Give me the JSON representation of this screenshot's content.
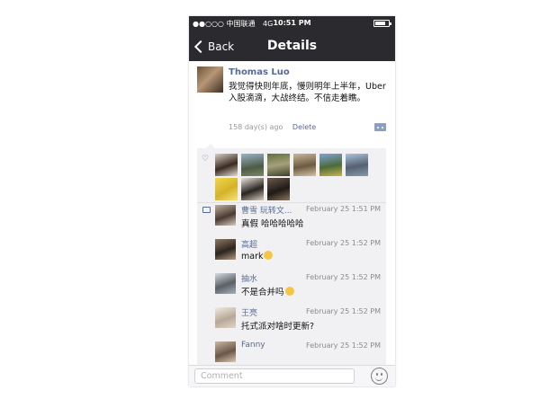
{
  "status_bar": {
    "signal": "●●○○○",
    "carrier": "中国联通",
    "network": "4G",
    "time": "10:51 PM"
  },
  "nav": {
    "back_label": "Back",
    "title": "Details"
  },
  "post": {
    "author": "Thomas Luo",
    "text": "我觉得快则年底，慢则明年上半年，Uber入股滴滴，大战终结。不信走着瞧。",
    "age": "158 day(s) ago",
    "delete_label": "Delete"
  },
  "likes": {
    "avatars": [
      "like-avatar",
      "like-avatar",
      "like-avatar",
      "like-avatar",
      "like-avatar",
      "like-avatar",
      "like-avatar",
      "like-avatar",
      "like-avatar",
      "like-avatar"
    ]
  },
  "comments": [
    {
      "name": "曹雪 玩转文...",
      "time": "February 25 1:51 PM",
      "text": "真假 哈哈哈哈哈"
    },
    {
      "name": "高超",
      "time": "February 25 1:52 PM",
      "text": "mark",
      "emoji": true
    },
    {
      "name": "抽水",
      "time": "February 25 1:52 PM",
      "text": "不是合并吗",
      "emoji": true
    },
    {
      "name": "王亮",
      "time": "February 25 1:52 PM",
      "text": "托式派对啥时更新?"
    },
    {
      "name": "Fanny",
      "time": "February 25 1:52 PM",
      "text": ""
    }
  ],
  "input": {
    "placeholder": "Comment"
  },
  "colors": {
    "nav_bg": "#2b2b2f",
    "link_blue": "#576b95",
    "comment_bg": "#f1f1f3"
  }
}
